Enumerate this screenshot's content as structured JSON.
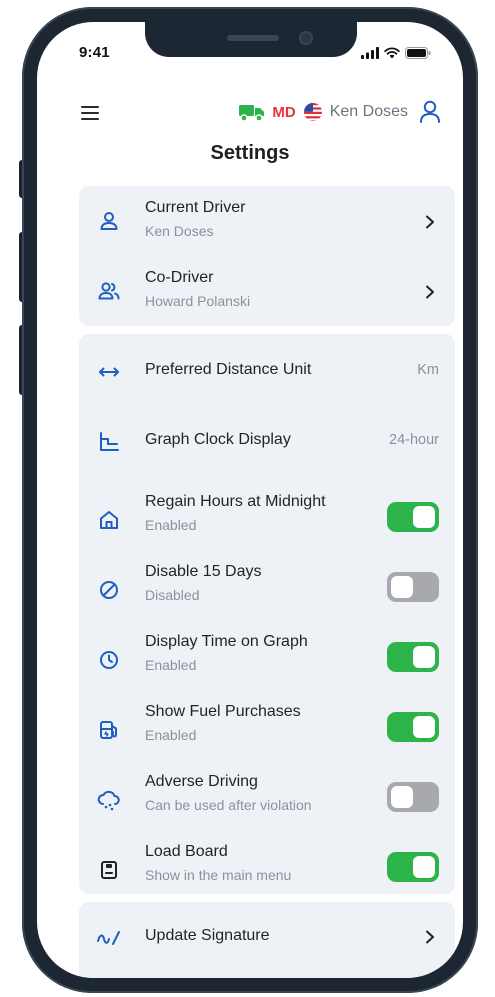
{
  "status_bar": {
    "time": "9:41"
  },
  "header": {
    "unit_code": "MD",
    "driver_name": "Ken Doses",
    "title": "Settings"
  },
  "drivers": [
    {
      "title": "Current Driver",
      "subtitle": "Ken Doses",
      "icon": "user-icon"
    },
    {
      "title": "Co-Driver",
      "subtitle": "Howard Polanski",
      "icon": "users-icon"
    }
  ],
  "preferences": [
    {
      "title": "Preferred Distance Unit",
      "value": "Km",
      "icon": "arrows-horizontal-icon"
    },
    {
      "title": "Graph Clock Display",
      "value": "24-hour",
      "icon": "graph-clock-icon"
    },
    {
      "title": "Regain Hours at Midnight",
      "subtitle": "Enabled",
      "enabled": true,
      "icon": "home-icon"
    },
    {
      "title": "Disable 15 Days",
      "subtitle": "Disabled",
      "enabled": false,
      "icon": "slash-circle-icon"
    },
    {
      "title": "Display Time on Graph",
      "subtitle": "Enabled",
      "enabled": true,
      "icon": "clock-icon"
    },
    {
      "title": "Show Fuel Purchases",
      "subtitle": "Enabled",
      "enabled": true,
      "icon": "fuel-pump-icon"
    },
    {
      "title": "Adverse Driving",
      "subtitle": "Can be used after violation",
      "enabled": false,
      "icon": "cloud-rain-icon"
    },
    {
      "title": "Load Board",
      "subtitle": "Show in the main menu",
      "enabled": true,
      "icon": "clipboard-icon"
    }
  ],
  "signature": {
    "title": "Update Signature",
    "icon": "signature-icon"
  },
  "colors": {
    "accent": "#1f5fbf",
    "toggle_on": "#2cb34a",
    "toggle_off": "#a7a9ad",
    "badge_red": "#e5353b",
    "truck_green": "#2cb34a",
    "card_bg": "#eef1f5"
  }
}
